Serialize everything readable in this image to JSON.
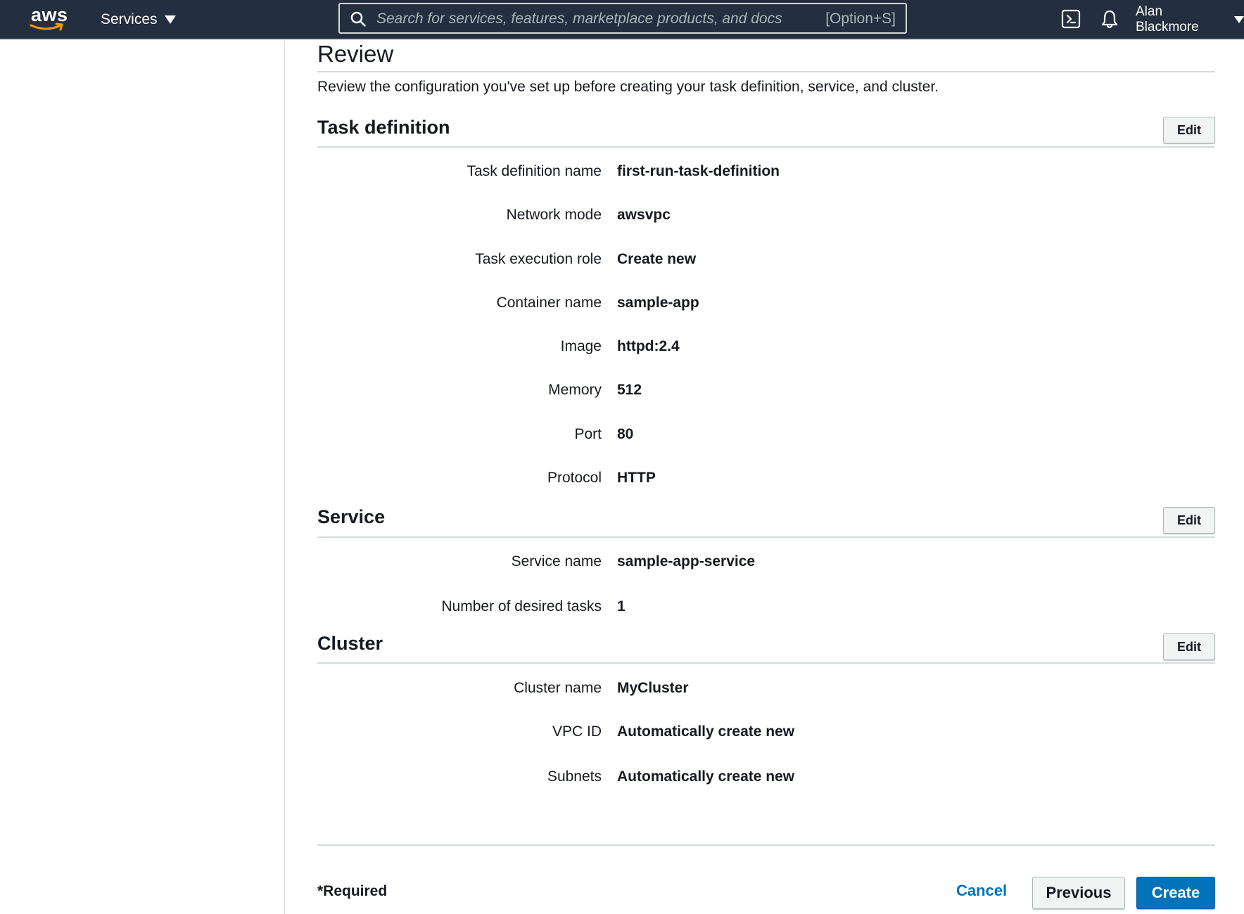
{
  "topnav": {
    "logo_text": "aws",
    "services_label": "Services",
    "search_placeholder": "Search for services, features, marketplace products, and docs",
    "search_shortcut": "[Option+S]",
    "user_name": "Alan Blackmore",
    "icons": [
      "aws-logo",
      "caret-down-icon",
      "search-icon",
      "cloudshell-icon",
      "bell-icon"
    ]
  },
  "page": {
    "title": "Review",
    "description": "Review the configuration you've set up before creating your task definition, service, and cluster."
  },
  "sections": {
    "task_definition": {
      "title": "Task definition",
      "edit_label": "Edit",
      "rows": [
        {
          "label": "Task definition name",
          "value": "first-run-task-definition"
        },
        {
          "label": "Network mode",
          "value": "awsvpc"
        },
        {
          "label": "Task execution role",
          "value": "Create new"
        },
        {
          "label": "Container name",
          "value": "sample-app"
        },
        {
          "label": "Image",
          "value": "httpd:2.4"
        },
        {
          "label": "Memory",
          "value": "512"
        },
        {
          "label": "Port",
          "value": "80"
        },
        {
          "label": "Protocol",
          "value": "HTTP"
        }
      ]
    },
    "service": {
      "title": "Service",
      "edit_label": "Edit",
      "rows": [
        {
          "label": "Service name",
          "value": "sample-app-service"
        },
        {
          "label": "Number of desired tasks",
          "value": "1"
        }
      ]
    },
    "cluster": {
      "title": "Cluster",
      "edit_label": "Edit",
      "rows": [
        {
          "label": "Cluster name",
          "value": "MyCluster"
        },
        {
          "label": "VPC ID",
          "value": "Automatically create new"
        },
        {
          "label": "Subnets",
          "value": "Automatically create new"
        }
      ]
    }
  },
  "footer": {
    "required_note": "*Required",
    "cancel_label": "Cancel",
    "previous_label": "Previous",
    "create_label": "Create"
  },
  "colors": {
    "nav_background": "#232f3e",
    "primary_button": "#0073bb",
    "link": "#0073bb",
    "divider": "#d5dbdb"
  }
}
